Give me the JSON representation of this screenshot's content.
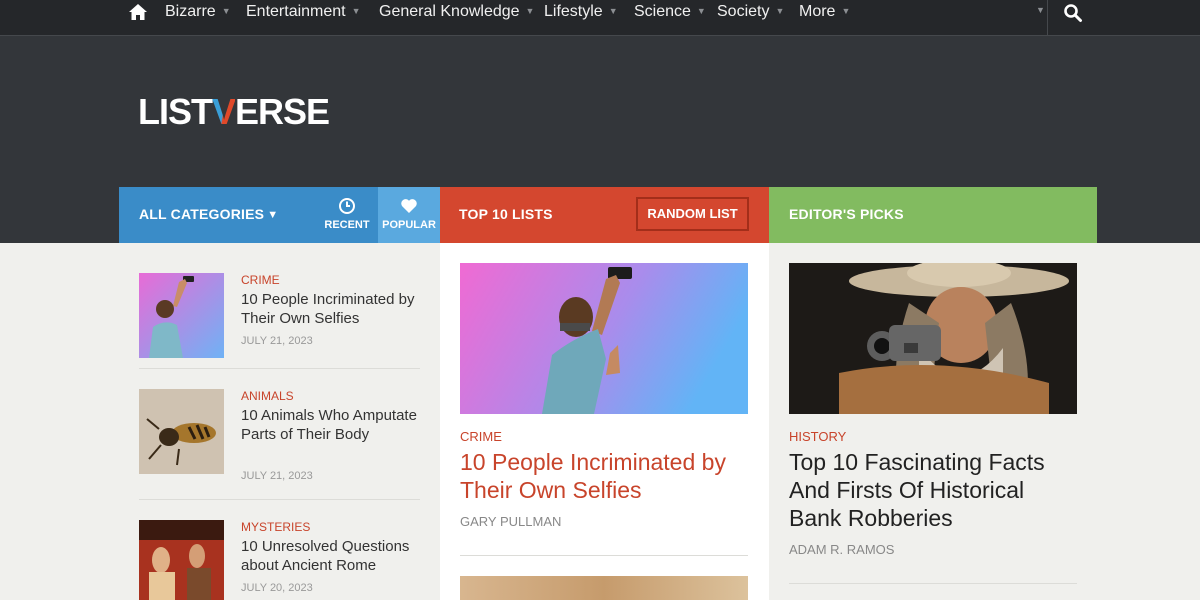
{
  "nav": {
    "items": [
      {
        "label": "Bizarre",
        "caret": "▼"
      },
      {
        "label": "Entertainment",
        "caret": "▼"
      },
      {
        "label": "General Knowledge",
        "caret": "▼"
      },
      {
        "label": "Lifestyle",
        "caret": "▼"
      },
      {
        "label": "Science",
        "caret": "▼"
      },
      {
        "label": "Society",
        "caret": "▼"
      },
      {
        "label": "More",
        "caret": "▼"
      }
    ],
    "extra_caret": "▼",
    "home_icon": "home-icon",
    "search_icon": "search-icon"
  },
  "logo": {
    "before": "LIST",
    "v": "V",
    "after": "ERSE"
  },
  "bars": {
    "categories_label": "ALL CATEGORIES",
    "categories_caret": "▼",
    "recent_label": "RECENT",
    "popular_label": "POPULAR",
    "top10_label": "TOP 10 LISTS",
    "random_label": "RANDOM LIST",
    "editors_label": "EDITOR'S PICKS"
  },
  "recent_list": [
    {
      "category": "CRIME",
      "title": "10 People Incriminated by Their Own Selfies",
      "date": "JULY 21, 2023"
    },
    {
      "category": "ANIMALS",
      "title": "10 Animals Who Amputate Parts of Their Body",
      "date": "JULY 21, 2023"
    },
    {
      "category": "MYSTERIES",
      "title": "10 Unresolved Questions about Ancient Rome",
      "date": "JULY 20, 2023"
    }
  ],
  "top10": {
    "category": "CRIME",
    "title": "10 People Incriminated by Their Own Selfies",
    "author": "GARY PULLMAN"
  },
  "editors": {
    "category": "HISTORY",
    "title": "Top 10 Fascinating Facts And Firsts Of Historical Bank Robberies",
    "author": "ADAM R. RAMOS"
  },
  "colors": {
    "nav_bg": "#25272a",
    "header_bg": "#33363a",
    "blue": "#3a8cc8",
    "red": "#d4472f",
    "green": "#82bb60",
    "accent_text": "#c8442b"
  }
}
